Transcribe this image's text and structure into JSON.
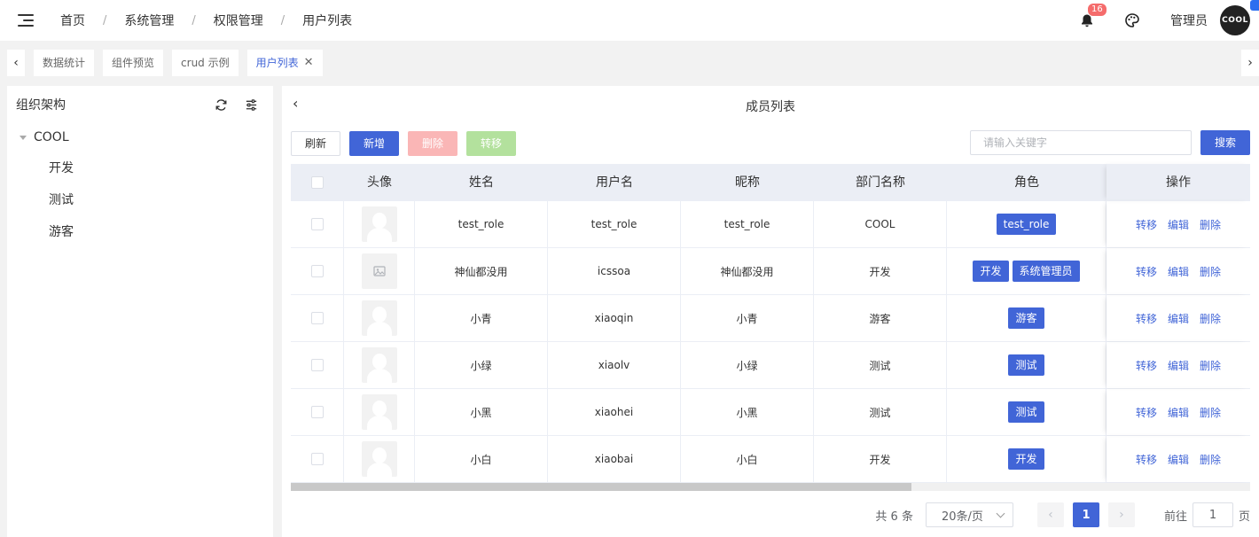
{
  "header": {
    "breadcrumb": [
      "首页",
      "系统管理",
      "权限管理",
      "用户列表"
    ],
    "separator": "/",
    "notification_count": "16",
    "user_name": "管理员",
    "avatar_text": "COOL"
  },
  "tabs": {
    "items": [
      {
        "label": "数据统计"
      },
      {
        "label": "组件预览"
      },
      {
        "label": "crud 示例"
      },
      {
        "label": "用户列表"
      }
    ],
    "close_glyph": "✕"
  },
  "sidebar": {
    "title": "组织架构",
    "root": "COOL",
    "children": [
      "开发",
      "测试",
      "游客"
    ]
  },
  "main": {
    "title": "成员列表",
    "buttons": {
      "refresh": "刷新",
      "add": "新增",
      "delete": "删除",
      "move": "转移",
      "search": "搜索"
    },
    "search_placeholder": "请输入关键字",
    "columns": [
      "头像",
      "姓名",
      "用户名",
      "昵称",
      "部门名称",
      "角色",
      "操作"
    ],
    "rows": [
      {
        "name": "test_role",
        "username": "test_role",
        "nickname": "test_role",
        "dept": "COOL",
        "roles": [
          "test_role"
        ],
        "avatar": "person"
      },
      {
        "name": "神仙都没用",
        "username": "icssoa",
        "nickname": "神仙都没用",
        "dept": "开发",
        "roles": [
          "开发",
          "系统管理员"
        ],
        "avatar": "image"
      },
      {
        "name": "小青",
        "username": "xiaoqin",
        "nickname": "小青",
        "dept": "游客",
        "roles": [
          "游客"
        ],
        "avatar": "person"
      },
      {
        "name": "小绿",
        "username": "xiaolv",
        "nickname": "小绿",
        "dept": "测试",
        "roles": [
          "测试"
        ],
        "avatar": "person"
      },
      {
        "name": "小黑",
        "username": "xiaohei",
        "nickname": "小黑",
        "dept": "测试",
        "roles": [
          "测试"
        ],
        "avatar": "person"
      },
      {
        "name": "小白",
        "username": "xiaobai",
        "nickname": "小白",
        "dept": "开发",
        "roles": [
          "开发"
        ],
        "avatar": "person"
      }
    ],
    "actions": [
      "转移",
      "编辑",
      "删除"
    ]
  },
  "pagination": {
    "total": "共 6 条",
    "page_size": "20条/页",
    "current_page": "1",
    "goto_prefix": "前往",
    "goto_value": "1",
    "goto_suffix": "页"
  },
  "colors": {
    "primary": "#4165d7",
    "danger_light": "#fab6b6",
    "success_light": "#b3e19d",
    "badge": "#f56c6c"
  }
}
